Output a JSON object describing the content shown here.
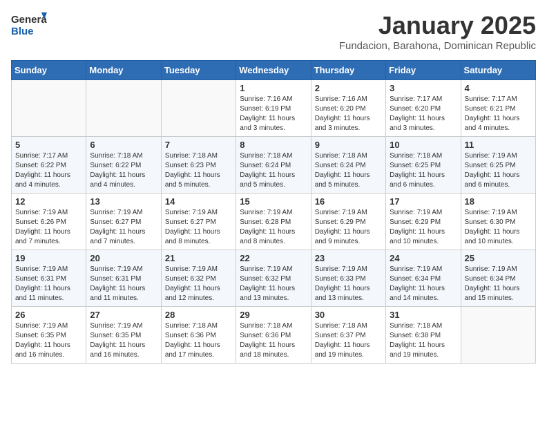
{
  "header": {
    "logo_general": "General",
    "logo_blue": "Blue",
    "month": "January 2025",
    "location": "Fundacion, Barahona, Dominican Republic"
  },
  "weekdays": [
    "Sunday",
    "Monday",
    "Tuesday",
    "Wednesday",
    "Thursday",
    "Friday",
    "Saturday"
  ],
  "weeks": [
    [
      {
        "day": "",
        "info": ""
      },
      {
        "day": "",
        "info": ""
      },
      {
        "day": "",
        "info": ""
      },
      {
        "day": "1",
        "info": "Sunrise: 7:16 AM\nSunset: 6:19 PM\nDaylight: 11 hours and 3 minutes."
      },
      {
        "day": "2",
        "info": "Sunrise: 7:16 AM\nSunset: 6:20 PM\nDaylight: 11 hours and 3 minutes."
      },
      {
        "day": "3",
        "info": "Sunrise: 7:17 AM\nSunset: 6:20 PM\nDaylight: 11 hours and 3 minutes."
      },
      {
        "day": "4",
        "info": "Sunrise: 7:17 AM\nSunset: 6:21 PM\nDaylight: 11 hours and 4 minutes."
      }
    ],
    [
      {
        "day": "5",
        "info": "Sunrise: 7:17 AM\nSunset: 6:22 PM\nDaylight: 11 hours and 4 minutes."
      },
      {
        "day": "6",
        "info": "Sunrise: 7:18 AM\nSunset: 6:22 PM\nDaylight: 11 hours and 4 minutes."
      },
      {
        "day": "7",
        "info": "Sunrise: 7:18 AM\nSunset: 6:23 PM\nDaylight: 11 hours and 5 minutes."
      },
      {
        "day": "8",
        "info": "Sunrise: 7:18 AM\nSunset: 6:24 PM\nDaylight: 11 hours and 5 minutes."
      },
      {
        "day": "9",
        "info": "Sunrise: 7:18 AM\nSunset: 6:24 PM\nDaylight: 11 hours and 5 minutes."
      },
      {
        "day": "10",
        "info": "Sunrise: 7:18 AM\nSunset: 6:25 PM\nDaylight: 11 hours and 6 minutes."
      },
      {
        "day": "11",
        "info": "Sunrise: 7:19 AM\nSunset: 6:25 PM\nDaylight: 11 hours and 6 minutes."
      }
    ],
    [
      {
        "day": "12",
        "info": "Sunrise: 7:19 AM\nSunset: 6:26 PM\nDaylight: 11 hours and 7 minutes."
      },
      {
        "day": "13",
        "info": "Sunrise: 7:19 AM\nSunset: 6:27 PM\nDaylight: 11 hours and 7 minutes."
      },
      {
        "day": "14",
        "info": "Sunrise: 7:19 AM\nSunset: 6:27 PM\nDaylight: 11 hours and 8 minutes."
      },
      {
        "day": "15",
        "info": "Sunrise: 7:19 AM\nSunset: 6:28 PM\nDaylight: 11 hours and 8 minutes."
      },
      {
        "day": "16",
        "info": "Sunrise: 7:19 AM\nSunset: 6:29 PM\nDaylight: 11 hours and 9 minutes."
      },
      {
        "day": "17",
        "info": "Sunrise: 7:19 AM\nSunset: 6:29 PM\nDaylight: 11 hours and 10 minutes."
      },
      {
        "day": "18",
        "info": "Sunrise: 7:19 AM\nSunset: 6:30 PM\nDaylight: 11 hours and 10 minutes."
      }
    ],
    [
      {
        "day": "19",
        "info": "Sunrise: 7:19 AM\nSunset: 6:31 PM\nDaylight: 11 hours and 11 minutes."
      },
      {
        "day": "20",
        "info": "Sunrise: 7:19 AM\nSunset: 6:31 PM\nDaylight: 11 hours and 11 minutes."
      },
      {
        "day": "21",
        "info": "Sunrise: 7:19 AM\nSunset: 6:32 PM\nDaylight: 11 hours and 12 minutes."
      },
      {
        "day": "22",
        "info": "Sunrise: 7:19 AM\nSunset: 6:32 PM\nDaylight: 11 hours and 13 minutes."
      },
      {
        "day": "23",
        "info": "Sunrise: 7:19 AM\nSunset: 6:33 PM\nDaylight: 11 hours and 13 minutes."
      },
      {
        "day": "24",
        "info": "Sunrise: 7:19 AM\nSunset: 6:34 PM\nDaylight: 11 hours and 14 minutes."
      },
      {
        "day": "25",
        "info": "Sunrise: 7:19 AM\nSunset: 6:34 PM\nDaylight: 11 hours and 15 minutes."
      }
    ],
    [
      {
        "day": "26",
        "info": "Sunrise: 7:19 AM\nSunset: 6:35 PM\nDaylight: 11 hours and 16 minutes."
      },
      {
        "day": "27",
        "info": "Sunrise: 7:19 AM\nSunset: 6:35 PM\nDaylight: 11 hours and 16 minutes."
      },
      {
        "day": "28",
        "info": "Sunrise: 7:18 AM\nSunset: 6:36 PM\nDaylight: 11 hours and 17 minutes."
      },
      {
        "day": "29",
        "info": "Sunrise: 7:18 AM\nSunset: 6:36 PM\nDaylight: 11 hours and 18 minutes."
      },
      {
        "day": "30",
        "info": "Sunrise: 7:18 AM\nSunset: 6:37 PM\nDaylight: 11 hours and 19 minutes."
      },
      {
        "day": "31",
        "info": "Sunrise: 7:18 AM\nSunset: 6:38 PM\nDaylight: 11 hours and 19 minutes."
      },
      {
        "day": "",
        "info": ""
      }
    ]
  ]
}
